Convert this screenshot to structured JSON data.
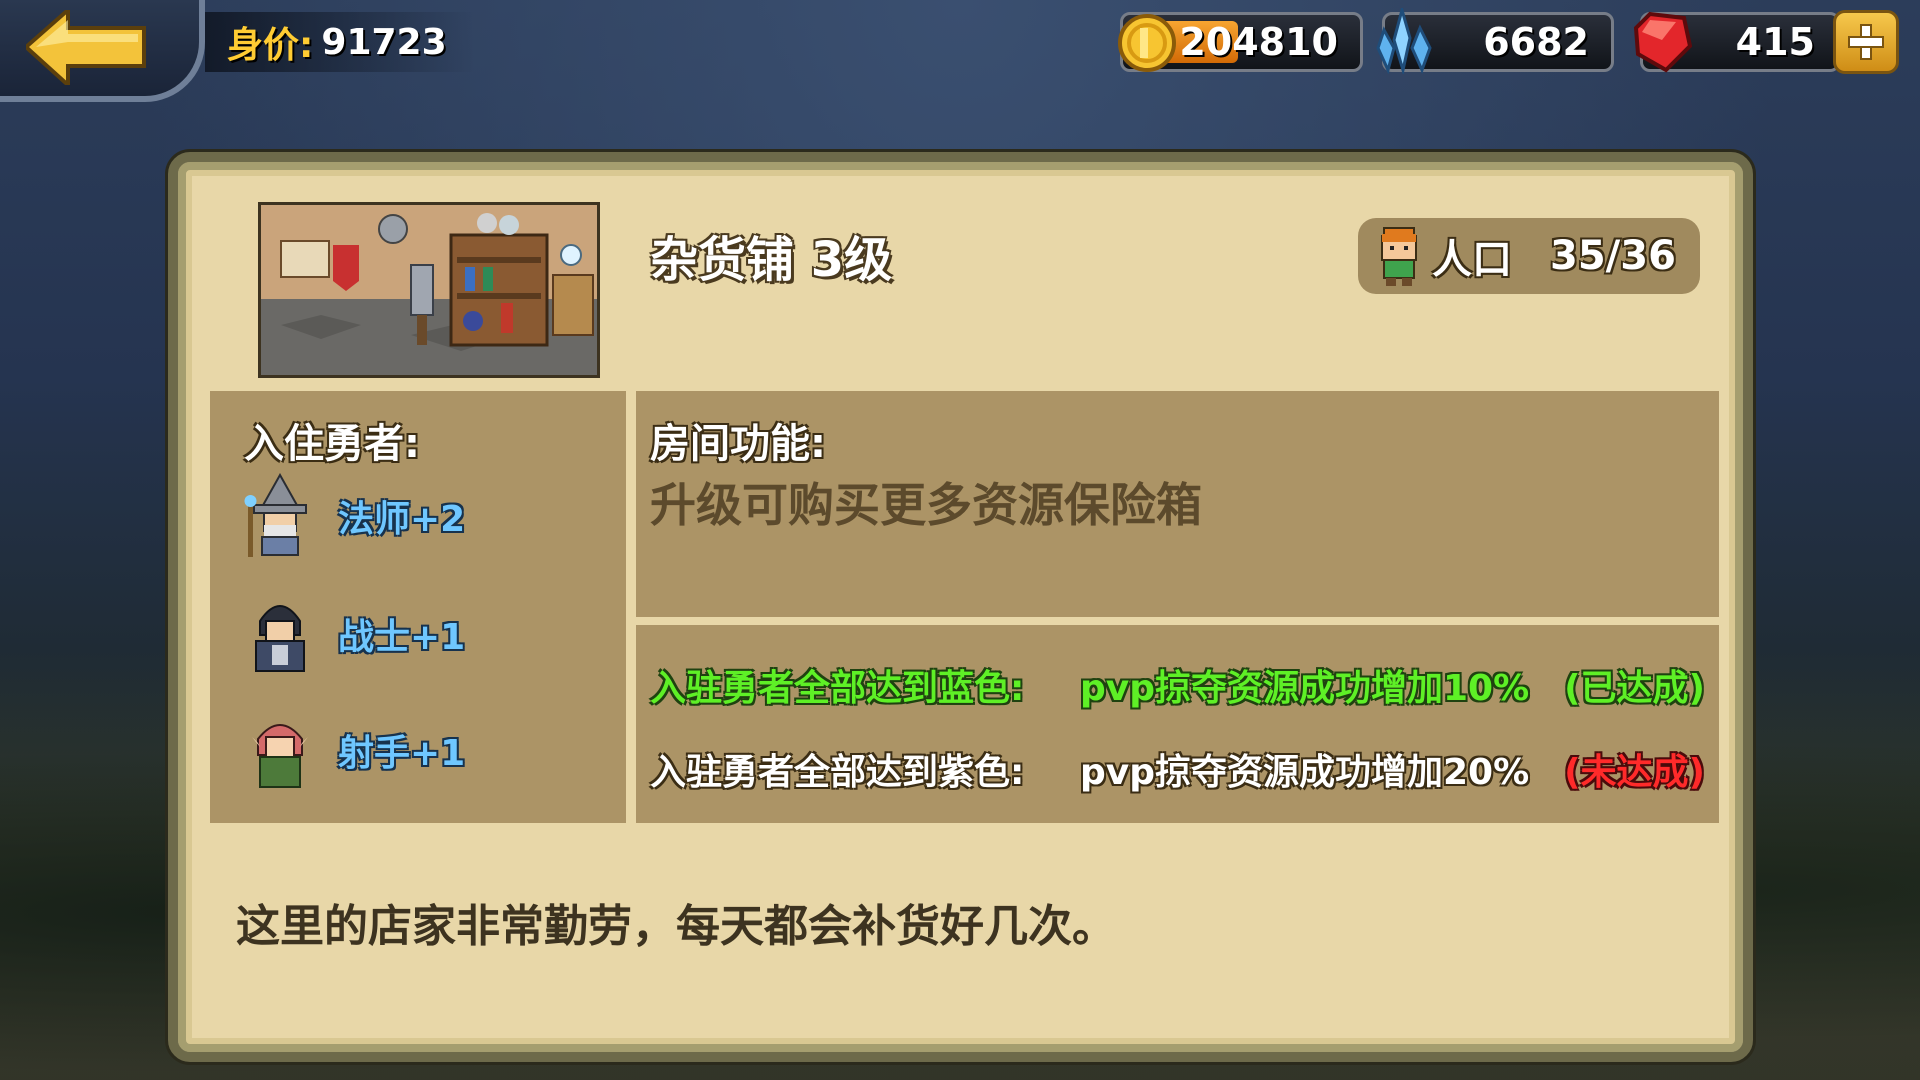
{
  "header": {
    "worth_label": "身价:",
    "worth_value": "91723",
    "gold": "204810",
    "gold_bar_fraction": 0.45,
    "crystal": "6682",
    "gems": "415"
  },
  "building": {
    "title": "杂货铺 3级",
    "population_label": "人口",
    "population_value": "35/36"
  },
  "heroes": {
    "heading": "入住勇者:",
    "items": [
      {
        "label": "法师+2",
        "icon": "mage-icon"
      },
      {
        "label": "战士+1",
        "icon": "warrior-icon"
      },
      {
        "label": "射手+1",
        "icon": "archer-icon"
      }
    ]
  },
  "function": {
    "heading": "房间功能:",
    "description": "升级可购买更多资源保险箱"
  },
  "bonuses": [
    {
      "condition": "入驻勇者全部达到蓝色:",
      "effect": "pvp掠夺资源成功增加10%",
      "status": "(已达成)"
    },
    {
      "condition": "入驻勇者全部达到紫色:",
      "effect": "pvp掠夺资源成功增加20%",
      "status": "(未达成)"
    }
  ],
  "flavor_text": "这里的店家非常勤劳，每天都会补货好几次。",
  "colors": {
    "achieved": "#5ef026",
    "not_achieved": "#ff2a2a",
    "hero_label": "#6fc7ff",
    "panel": "#e8d7a8"
  }
}
